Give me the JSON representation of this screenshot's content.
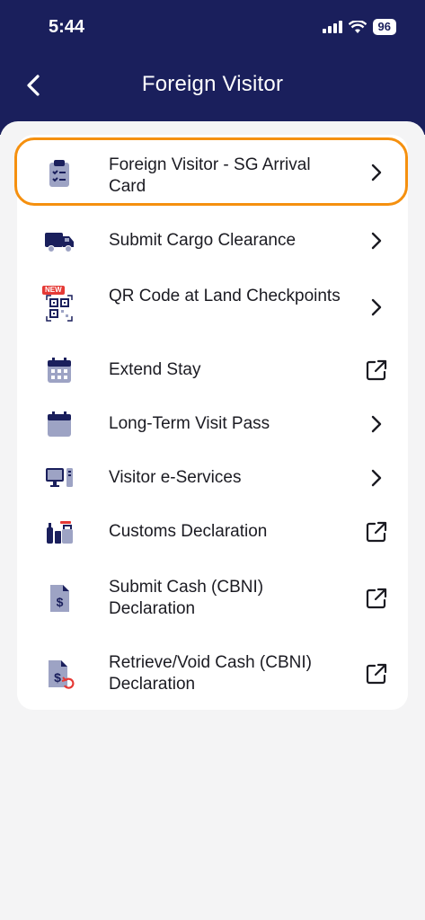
{
  "status_bar": {
    "time": "5:44",
    "battery": "96"
  },
  "header": {
    "title": "Foreign Visitor"
  },
  "items": [
    {
      "label": "Foreign Visitor - SG Arrival Card",
      "icon": "clipboard-checklist-icon",
      "action": "chevron-right-icon"
    },
    {
      "label": "Submit Cargo Clearance",
      "icon": "truck-icon",
      "action": "chevron-right-icon"
    },
    {
      "label": "QR Code at Land Checkpoints",
      "icon": "qr-code-icon",
      "badge": "NEW",
      "action": "chevron-right-icon"
    },
    {
      "label": "Extend Stay",
      "icon": "calendar-grid-icon",
      "action": "external-link-icon"
    },
    {
      "label": "Long-Term Visit Pass",
      "icon": "calendar-icon",
      "action": "chevron-right-icon"
    },
    {
      "label": "Visitor e-Services",
      "icon": "computer-icon",
      "action": "chevron-right-icon"
    },
    {
      "label": "Customs Declaration",
      "icon": "goods-declaration-icon",
      "action": "external-link-icon"
    },
    {
      "label": "Submit Cash (CBNI) Declaration",
      "icon": "cash-document-icon",
      "action": "external-link-icon"
    },
    {
      "label": "Retrieve/Void Cash (CBNI) Declaration",
      "icon": "cash-document-retrieve-icon",
      "action": "external-link-icon"
    }
  ],
  "colors": {
    "header": "#1a1f5c",
    "highlight": "#f5900f",
    "icon_dark": "#1a1f5c",
    "icon_light": "#9da3c4",
    "accent_red": "#e53935"
  }
}
